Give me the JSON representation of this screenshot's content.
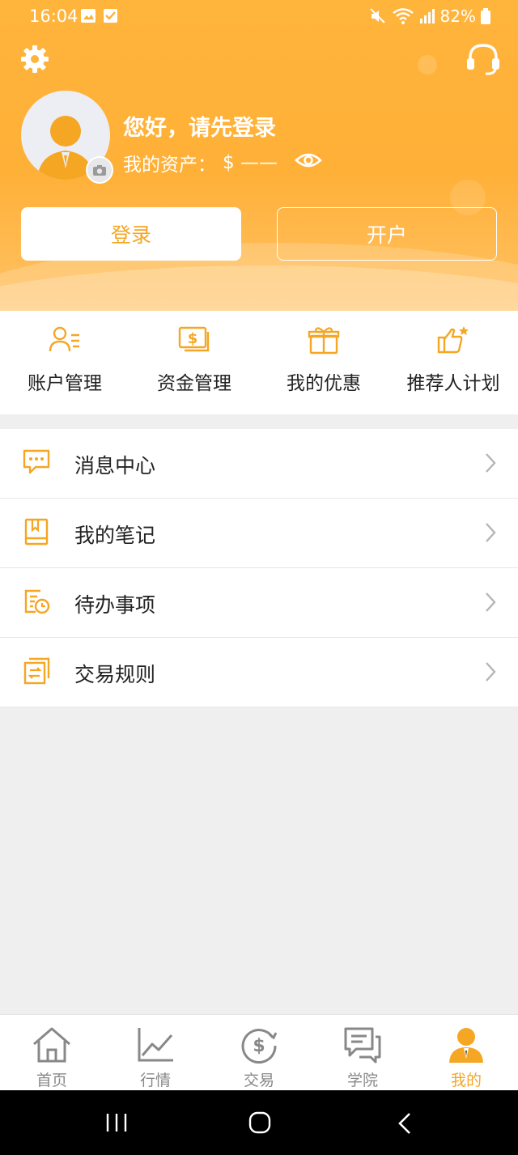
{
  "status": {
    "time": "16:04",
    "battery": "82%"
  },
  "profile": {
    "greeting": "您好，请先登录",
    "assets_label": "我的资产：",
    "assets_value": "$ ——"
  },
  "actions": {
    "login": "登录",
    "open_account": "开户"
  },
  "quick_items": [
    {
      "label": "账户管理",
      "icon": "account-manage-icon"
    },
    {
      "label": "资金管理",
      "icon": "fund-manage-icon"
    },
    {
      "label": "我的优惠",
      "icon": "gift-icon"
    },
    {
      "label": "推荐人计划",
      "icon": "thumbs-up-icon"
    }
  ],
  "menu_items": [
    {
      "label": "消息中心",
      "icon": "message-icon"
    },
    {
      "label": "我的笔记",
      "icon": "notebook-icon"
    },
    {
      "label": "待办事项",
      "icon": "todo-icon"
    },
    {
      "label": "交易规则",
      "icon": "rules-icon"
    }
  ],
  "tabs": [
    {
      "label": "首页",
      "icon": "home-icon"
    },
    {
      "label": "行情",
      "icon": "chart-icon"
    },
    {
      "label": "交易",
      "icon": "dollar-icon"
    },
    {
      "label": "学院",
      "icon": "chat-icon"
    },
    {
      "label": "我的",
      "icon": "person-icon",
      "active": true
    }
  ],
  "colors": {
    "accent": "#f5a623",
    "hero": "#ffb037"
  }
}
